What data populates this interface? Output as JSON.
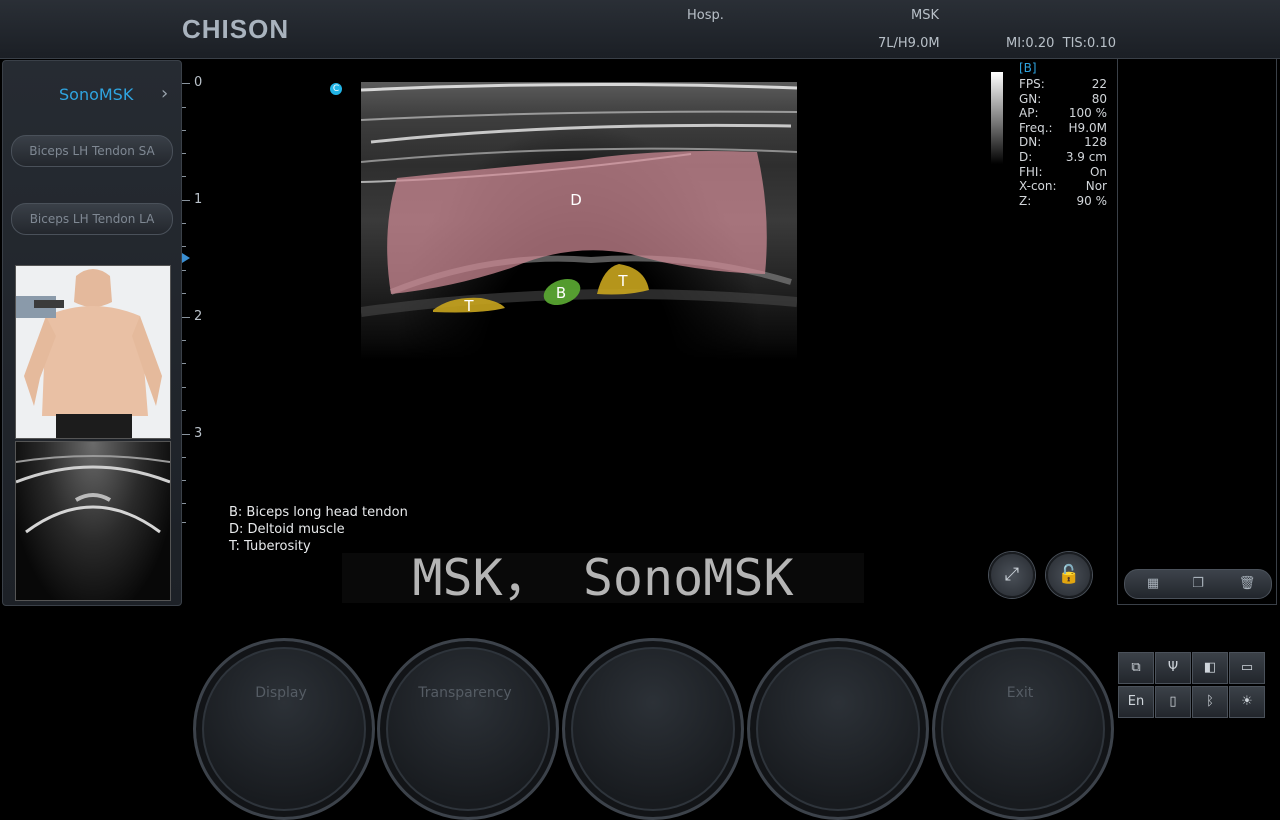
{
  "header": {
    "brand": "CHISON",
    "hospital": "Hosp.",
    "exam": "MSK",
    "probe": "7L/H9.0M",
    "mi_tis": "MI:0.20  TIS:0.10"
  },
  "left_panel": {
    "title": "SonoMSK",
    "chevron": "›",
    "presets": [
      "Biceps LH Tendon SA",
      "Biceps LH Tendon LA"
    ]
  },
  "depth_scale": {
    "labels": [
      "0",
      "1",
      "2",
      "3"
    ],
    "max_depth_cm": 3.9
  },
  "image": {
    "annotations": [
      {
        "label": "D",
        "color": "#d08b96"
      },
      {
        "label": "B",
        "color": "#5aa832"
      },
      {
        "label": "T",
        "color": "#c9a51e"
      },
      {
        "label": "T",
        "color": "#c9a51e"
      }
    ],
    "c_icon": "C"
  },
  "params": {
    "header": "[B]",
    "rows": [
      {
        "k": "FPS:",
        "v": "22"
      },
      {
        "k": "GN:",
        "v": "80"
      },
      {
        "k": "AP:",
        "v": "100 %"
      },
      {
        "k": "Freq.:",
        "v": "H9.0M"
      },
      {
        "k": "DN:",
        "v": "128"
      },
      {
        "k": "D:",
        "v": "3.9 cm"
      },
      {
        "k": "FHI:",
        "v": "On"
      },
      {
        "k": "X-con:",
        "v": "Nor"
      },
      {
        "k": "Z:",
        "v": "90 %"
      }
    ]
  },
  "legend": [
    "B: Biceps long head tendon",
    "D: Deltoid muscle",
    "T: Tuberosity"
  ],
  "subtitle": "MSK， SonoMSK",
  "knobs": [
    "Display",
    "Transparency",
    "",
    "",
    "Exit"
  ],
  "system": {
    "lang": "En"
  }
}
